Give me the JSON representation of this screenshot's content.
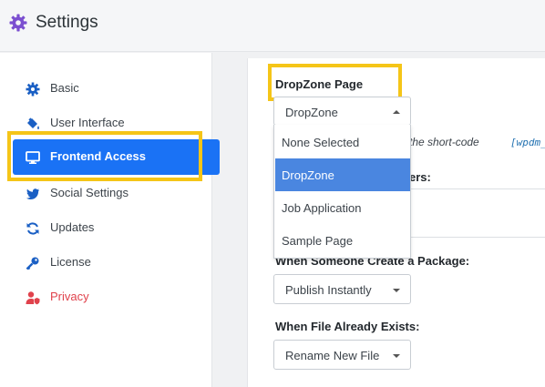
{
  "header": {
    "title": "Settings"
  },
  "sidebar": {
    "items": [
      {
        "label": "Basic",
        "icon": "gear-icon"
      },
      {
        "label": "User Interface",
        "icon": "paint-bucket-icon"
      },
      {
        "label": "Frontend Access",
        "icon": "monitor-icon",
        "active": true
      },
      {
        "label": "Social Settings",
        "icon": "twitter-icon"
      },
      {
        "label": "Updates",
        "icon": "sync-icon"
      },
      {
        "label": "License",
        "icon": "key-icon"
      },
      {
        "label": "Privacy",
        "icon": "user-shield-icon",
        "color": "#e0424c"
      }
    ]
  },
  "main": {
    "section_title": "DropZone Page",
    "dropzone_select": {
      "value": "DropZone",
      "options": [
        "None Selected",
        "DropZone",
        "Job Application",
        "Sample Page"
      ],
      "selected_index": 1
    },
    "helper_text": "the short-code",
    "shortcode": "[wpdm_",
    "obscured_label_fragment": "ers:",
    "package_label": "When Someone Create a Package:",
    "package_select": {
      "value": "Publish Instantly"
    },
    "file_exists_label": "When File Already Exists:",
    "file_exists_select": {
      "value": "Rename New File"
    }
  },
  "colors": {
    "accent": "#1a72f5",
    "highlight": "#f5c518",
    "option_selected": "#4a86e0",
    "danger": "#e0424c"
  }
}
